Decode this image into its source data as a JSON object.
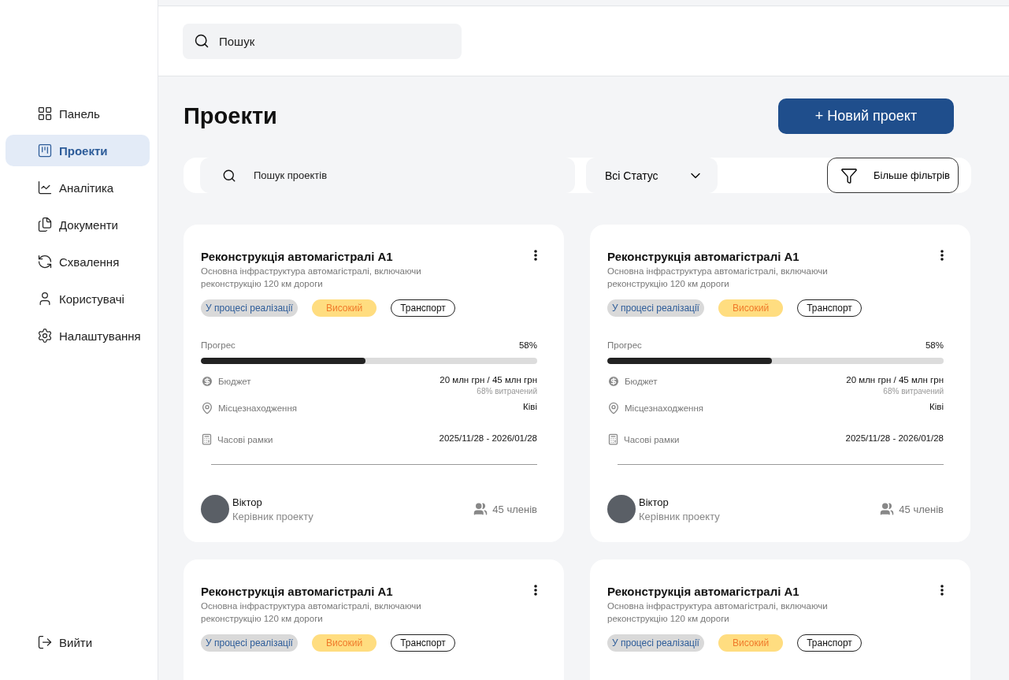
{
  "sidebar": {
    "items": [
      {
        "label": "Панель",
        "selected": false
      },
      {
        "label": "Проекти",
        "selected": true
      },
      {
        "label": "Аналітика",
        "selected": false
      },
      {
        "label": "Документи",
        "selected": false
      },
      {
        "label": "Схвалення",
        "selected": false
      },
      {
        "label": "Користувачі",
        "selected": false
      },
      {
        "label": "Налаштування",
        "selected": false
      }
    ],
    "logout": "Вийти"
  },
  "header": {
    "search": {
      "placeholder": "Пошук"
    }
  },
  "page": {
    "title": "Проекти",
    "new_button": "+ Новий проект"
  },
  "filters": {
    "search": {
      "placeholder": "Пошук проектів"
    },
    "status": "Всі Статус",
    "more": "Більше фільтрів"
  },
  "projects": [
    {
      "title": "Реконструкція автомагістралі A1",
      "description": "Основна інфраструктура автомагістралі, включаючи реконструкцію 120 км дороги",
      "tags": [
        {
          "label": "У процесі реалізації",
          "kind": "status"
        },
        {
          "label": "Високий",
          "kind": "priority"
        },
        {
          "label": "Транспорт",
          "kind": "category"
        }
      ],
      "progress": {
        "label": "Прогрес",
        "reading": "58%",
        "level": 0.49
      },
      "budget": {
        "label": "Бюджет",
        "value": "20 млн грн / 45 млн грн",
        "note": "68% витрачений"
      },
      "location": {
        "label": "Місцезнаходження",
        "value": "Ківі"
      },
      "timeline": {
        "label": "Часові рамки",
        "value": "2025/11/28 - 2026/01/28"
      },
      "manager": {
        "name": "Віктор",
        "role": "Керівник проекту"
      },
      "members": "45 членів"
    },
    {
      "title": "Реконструкція автомагістралі A1",
      "description": "Основна інфраструктура автомагістралі, включаючи реконструкцію 120 км дороги",
      "tags": [
        {
          "label": "У процесі реалізації",
          "kind": "status"
        },
        {
          "label": "Високий",
          "kind": "priority"
        },
        {
          "label": "Транспорт",
          "kind": "category"
        }
      ],
      "progress": {
        "label": "Прогрес",
        "reading": "58%",
        "level": 0.49
      },
      "budget": {
        "label": "Бюджет",
        "value": "20 млн грн / 45 млн грн",
        "note": "68% витрачений"
      },
      "location": {
        "label": "Місцезнаходження",
        "value": "Ківі"
      },
      "timeline": {
        "label": "Часові рамки",
        "value": "2025/11/28 - 2026/01/28"
      },
      "manager": {
        "name": "Віктор",
        "role": "Керівник проекту"
      },
      "members": "45 членів"
    },
    {
      "title": "Реконструкція автомагістралі A1",
      "description": "Основна інфраструктура автомагістралі, включаючи реконструкцію 120 км дороги",
      "tags": [
        {
          "label": "У процесі реалізації",
          "kind": "status"
        },
        {
          "label": "Високий",
          "kind": "priority"
        },
        {
          "label": "Транспорт",
          "kind": "category"
        }
      ]
    },
    {
      "title": "Реконструкція автомагістралі A1",
      "description": "Основна інфраструктура автомагістралі, включаючи реконструкцію 120 км дороги",
      "tags": [
        {
          "label": "У процесі реалізації",
          "kind": "status"
        },
        {
          "label": "Високий",
          "kind": "priority"
        },
        {
          "label": "Транспорт",
          "kind": "category"
        }
      ]
    }
  ]
}
